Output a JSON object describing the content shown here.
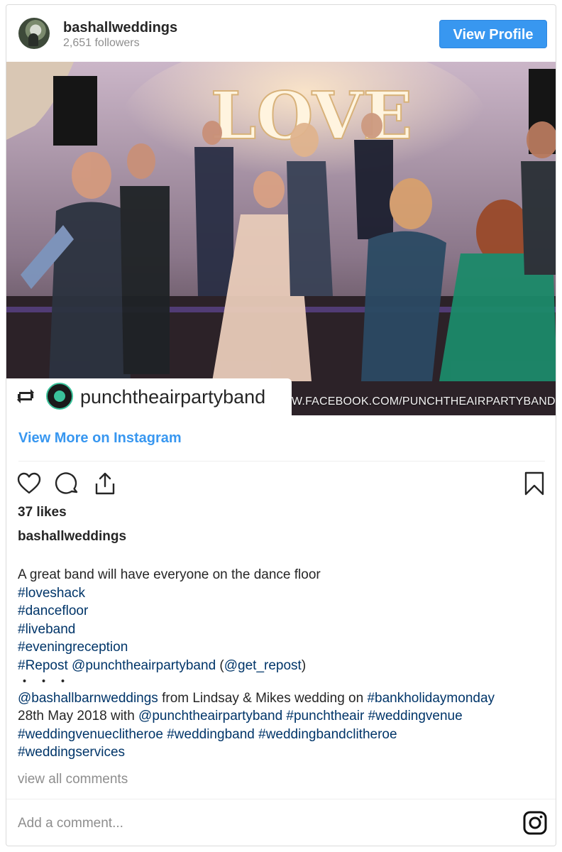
{
  "header": {
    "username": "bashallweddings",
    "followers": "2,651 followers",
    "view_profile_label": "View Profile",
    "accent_color": "#3897f0"
  },
  "photo": {
    "sign_text": "LOVE",
    "repost_user": "punchtheairpartyband",
    "watermark": "W.FACEBOOK.COM/PUNCHTHEAIRPARTYBAND"
  },
  "links": {
    "view_more": "View More on Instagram"
  },
  "actions": {
    "icons": [
      "heart-icon",
      "comment-icon",
      "share-icon",
      "bookmark-icon"
    ]
  },
  "likes": "37 likes",
  "caption": {
    "author": "bashallweddings",
    "lines": [
      {
        "segments": [
          {
            "t": "A great band will have everyone on the dance floor",
            "tag": false
          }
        ]
      },
      {
        "segments": [
          {
            "t": "#loveshack",
            "tag": true
          }
        ]
      },
      {
        "segments": [
          {
            "t": "#dancefloor",
            "tag": true
          }
        ]
      },
      {
        "segments": [
          {
            "t": "#liveband",
            "tag": true
          }
        ]
      },
      {
        "segments": [
          {
            "t": "#eveningreception",
            "tag": true
          }
        ]
      },
      {
        "segments": [
          {
            "t": "#Repost @punchtheairpartyband",
            "tag": true
          },
          {
            "t": " (",
            "tag": false
          },
          {
            "t": "@get_repost",
            "tag": true
          },
          {
            "t": ")",
            "tag": false
          }
        ]
      },
      {
        "segments": [
          {
            "t": "・・・",
            "tag": false
          }
        ]
      },
      {
        "segments": [
          {
            "t": "@bashallbarnweddings",
            "tag": true
          },
          {
            "t": " from Lindsay & Mikes wedding on ",
            "tag": false
          },
          {
            "t": "#bankholidaymonday",
            "tag": true
          }
        ]
      },
      {
        "segments": [
          {
            "t": "28th May 2018 with ",
            "tag": false
          },
          {
            "t": "@punchtheairpartyband",
            "tag": true
          },
          {
            "t": " ",
            "tag": false
          },
          {
            "t": "#punchtheair",
            "tag": true
          },
          {
            "t": " ",
            "tag": false
          },
          {
            "t": "#weddingvenue",
            "tag": true
          }
        ]
      },
      {
        "segments": [
          {
            "t": "#weddingvenueclitheroe",
            "tag": true
          },
          {
            "t": " ",
            "tag": false
          },
          {
            "t": "#weddingband",
            "tag": true
          },
          {
            "t": " ",
            "tag": false
          },
          {
            "t": "#weddingbandclitheroe",
            "tag": true
          }
        ]
      },
      {
        "segments": [
          {
            "t": "#weddingservices",
            "tag": true
          }
        ]
      }
    ]
  },
  "comments": {
    "view_all": "view all comments",
    "placeholder": "Add a comment..."
  },
  "colors": {
    "hashtag": "#003569",
    "muted": "#8e8e8e",
    "text": "#262626"
  }
}
